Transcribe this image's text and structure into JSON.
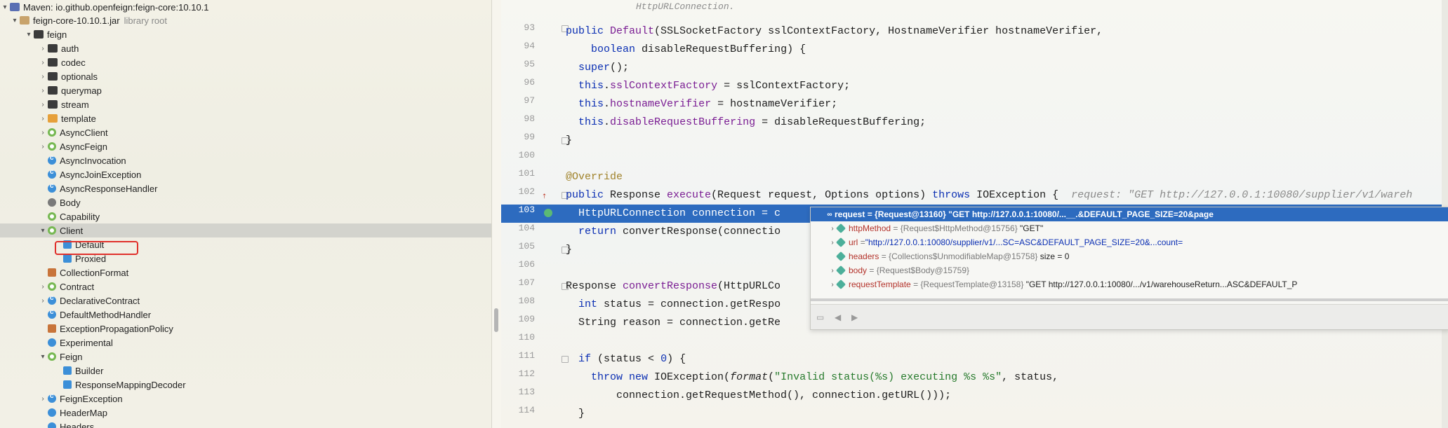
{
  "tree": {
    "maven_label": "Maven: io.github.openfeign:feign-core:10.10.1",
    "jar_label": "feign-core-10.10.1.jar",
    "jar_note": "library root",
    "items": [
      {
        "label": "feign",
        "icon": "package-folder-icon"
      },
      {
        "label": "auth",
        "icon": "package-folder-icon"
      },
      {
        "label": "codec",
        "icon": "package-folder-icon"
      },
      {
        "label": "optionals",
        "icon": "package-folder-icon"
      },
      {
        "label": "querymap",
        "icon": "package-folder-icon"
      },
      {
        "label": "stream",
        "icon": "package-folder-icon"
      },
      {
        "label": "template",
        "icon": "package-folder-icon"
      },
      {
        "label": "AsyncClient",
        "icon": "interface-icon"
      },
      {
        "label": "AsyncFeign",
        "icon": "interface-icon"
      },
      {
        "label": "AsyncInvocation",
        "icon": "class-icon"
      },
      {
        "label": "AsyncJoinException",
        "icon": "class-icon"
      },
      {
        "label": "AsyncResponseHandler",
        "icon": "class-icon"
      },
      {
        "label": "Body",
        "icon": "annotation-icon"
      },
      {
        "label": "Capability",
        "icon": "interface-icon"
      },
      {
        "label": "Client",
        "icon": "interface-icon"
      },
      {
        "label": "Default",
        "icon": "inner-class-icon"
      },
      {
        "label": "Proxied",
        "icon": "inner-class-icon"
      },
      {
        "label": "CollectionFormat",
        "icon": "enum-icon"
      },
      {
        "label": "Contract",
        "icon": "interface-icon"
      },
      {
        "label": "DeclarativeContract",
        "icon": "class-icon"
      },
      {
        "label": "DefaultMethodHandler",
        "icon": "class-icon"
      },
      {
        "label": "ExceptionPropagationPolicy",
        "icon": "enum-icon"
      },
      {
        "label": "Experimental",
        "icon": "annotation-icon"
      },
      {
        "label": "Feign",
        "icon": "interface-icon"
      },
      {
        "label": "Builder",
        "icon": "inner-class-icon"
      },
      {
        "label": "ResponseMappingDecoder",
        "icon": "inner-class-icon"
      },
      {
        "label": "FeignException",
        "icon": "class-icon"
      },
      {
        "label": "HeaderMap",
        "icon": "annotation-icon"
      },
      {
        "label": "Headers",
        "icon": "annotation-icon"
      }
    ]
  },
  "editor": {
    "comment_line": "HttpURLConnection.",
    "line_numbers": [
      "93",
      "94",
      "95",
      "96",
      "97",
      "98",
      "99",
      "100",
      "101",
      "102",
      "103",
      "104",
      "105",
      "106",
      "107",
      "108",
      "109",
      "110",
      "111",
      "112",
      "113",
      "114"
    ],
    "inline_hint": "request: \"GET http://127.0.0.1:10080/supplier/v1/wareh"
  },
  "popup": {
    "head": {
      "name": "request",
      "ref": "= {Request@13160}",
      "value": "\"GET http://127.0.0.1:10080/...__.&DEFAULT_PAGE_SIZE=20&page"
    },
    "rows": [
      {
        "name": "httpMethod",
        "ref": "= {Request$HttpMethod@15756}",
        "value": "\"GET\""
      },
      {
        "name": "url",
        "ref": "= ",
        "value": "\"http://127.0.0.1:10080/supplier/v1/...SC=ASC&DEFAULT_PAGE_SIZE=20&...count="
      },
      {
        "name": "headers",
        "ref": "= {Collections$UnmodifiableMap@15758}",
        "value": "size = 0"
      },
      {
        "name": "body",
        "ref": "= {Request$Body@15759}",
        "value": ""
      },
      {
        "name": "requestTemplate",
        "ref": "= {RequestTemplate@13158}",
        "value": "\"GET http://127.0.0.1:10080/.../v1/warehouseReturn...ASC&DEFAULT_P"
      }
    ],
    "nav": [
      "◀",
      "▶"
    ]
  },
  "colors": {
    "selection": "#2d6bbf",
    "highlight_box": "#e0302b"
  }
}
